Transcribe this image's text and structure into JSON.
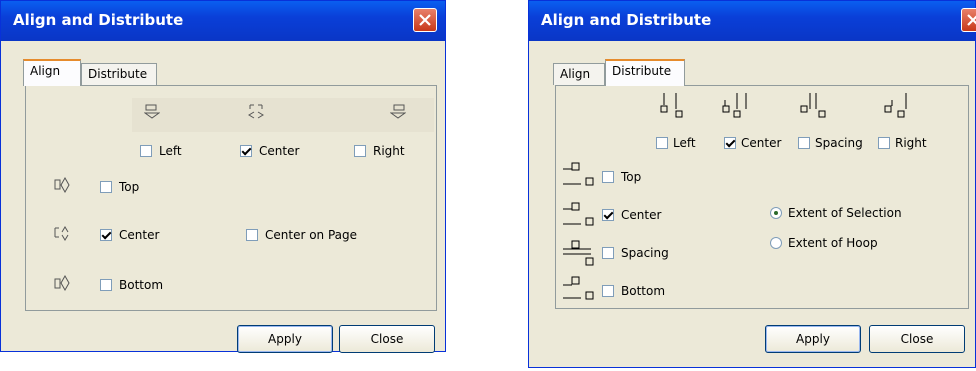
{
  "left_dialog": {
    "title": "Align and Distribute",
    "tabs": [
      "Align",
      "Distribute"
    ],
    "active_tab": "Align",
    "horizontal": [
      {
        "label": "Left",
        "checked": false,
        "icon": "align-left-icon"
      },
      {
        "label": "Center",
        "checked": true,
        "icon": "align-center-h-icon"
      },
      {
        "label": "Right",
        "checked": false,
        "icon": "align-right-icon"
      }
    ],
    "vertical": [
      {
        "label": "Top",
        "checked": false,
        "icon": "align-top-icon"
      },
      {
        "label": "Center",
        "checked": true,
        "icon": "align-center-v-icon"
      },
      {
        "label": "Bottom",
        "checked": false,
        "icon": "align-bottom-icon"
      }
    ],
    "center_on_page": {
      "label": "Center on Page",
      "checked": false
    },
    "apply_label": "Apply",
    "close_label": "Close"
  },
  "right_dialog": {
    "title": "Align and Distribute",
    "tabs": [
      "Align",
      "Distribute"
    ],
    "active_tab": "Distribute",
    "horizontal": [
      {
        "label": "Left",
        "checked": false,
        "icon": "distribute-left-icon"
      },
      {
        "label": "Center",
        "checked": true,
        "icon": "distribute-center-icon"
      },
      {
        "label": "Spacing",
        "checked": false,
        "icon": "distribute-spacing-icon"
      },
      {
        "label": "Right",
        "checked": false,
        "icon": "distribute-right-icon"
      }
    ],
    "vertical": [
      {
        "label": "Top",
        "checked": false,
        "icon": "distribute-top-icon"
      },
      {
        "label": "Center",
        "checked": true,
        "icon": "distribute-vcenter-icon"
      },
      {
        "label": "Spacing",
        "checked": false,
        "icon": "distribute-vspacing-icon"
      },
      {
        "label": "Bottom",
        "checked": false,
        "icon": "distribute-bottom-icon"
      }
    ],
    "extent": [
      {
        "label": "Extent of Selection",
        "selected": true
      },
      {
        "label": "Extent of Hoop",
        "selected": false
      }
    ],
    "apply_label": "Apply",
    "close_label": "Close"
  }
}
